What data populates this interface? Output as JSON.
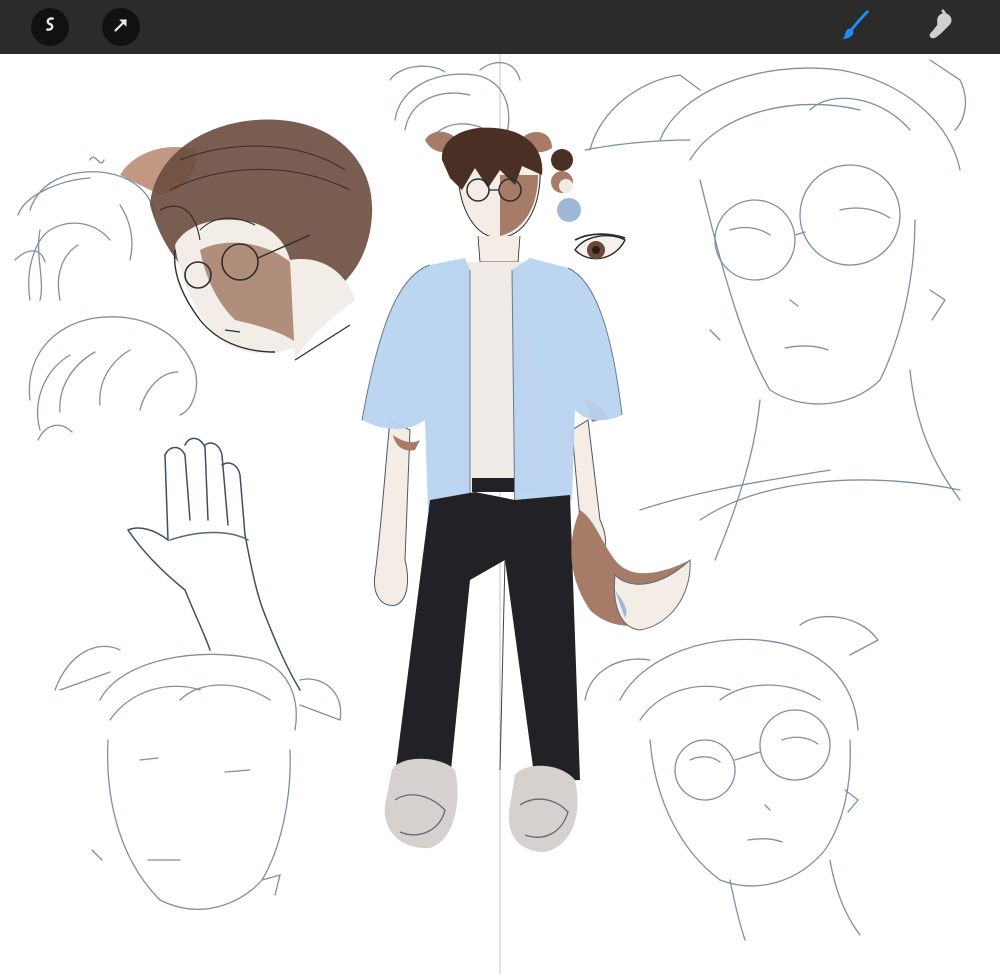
{
  "app": {
    "toolbar": {
      "left_icons": [
        "adjustments-icon",
        "selection-arrow-icon"
      ],
      "right_icons": [
        "brush-icon",
        "smudge-icon"
      ],
      "active_tool": "brush"
    }
  },
  "colors": {
    "toolbar_bg": "#2b2b2b",
    "brush_active": "#1e8fff",
    "sketch_line": "#7f8fa1",
    "hair_brown": "#4a2f25",
    "fur_brown": "#a67b67",
    "skin": "#f4ede6",
    "shirt_blue": "#b8d3ef",
    "pants_black": "#222226",
    "shoes_gray": "#d6d1cf",
    "swatch_blue": "#9fb7d6"
  },
  "palette_swatches": [
    "#4a2f25",
    "#a67b67",
    "#f2ebe4",
    "#9fb7d6"
  ]
}
